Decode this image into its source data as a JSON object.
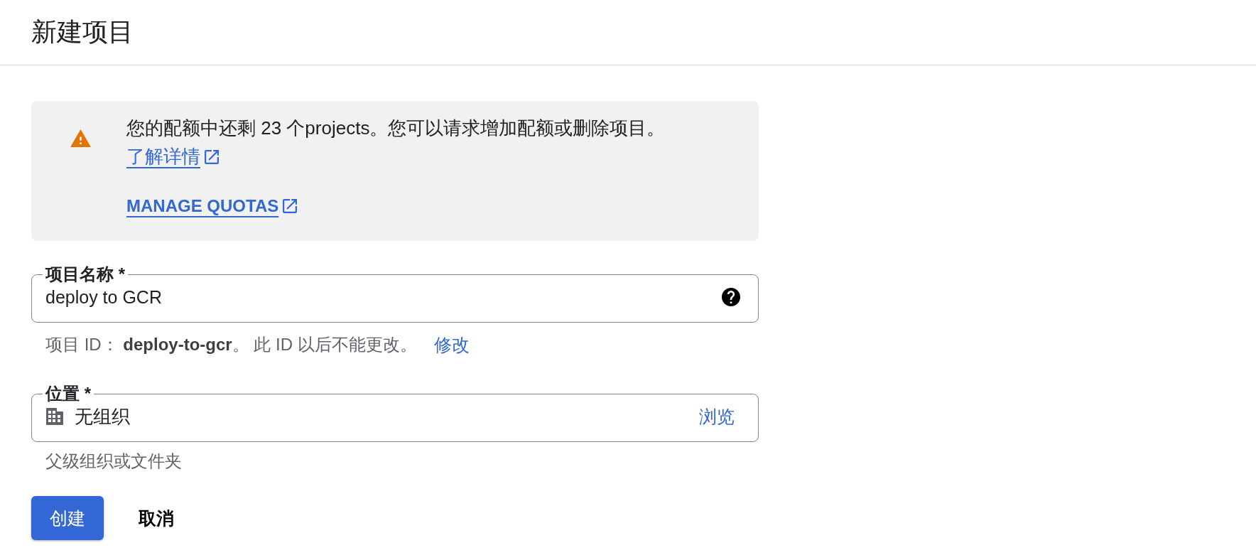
{
  "page": {
    "title": "新建项目"
  },
  "notice": {
    "kind": "warning",
    "message": "您的配额中还剩 23 个projects。您可以请求增加配额或删除项目。",
    "learn_more_link": "了解详情",
    "manage_link": "MANAGE QUOTAS"
  },
  "fields": [
    {
      "kind": "text",
      "label": "项目名称 *",
      "value": "deploy to GCR",
      "hint": "项目 ID： **deploy-to-gcr**。 此 ID 以后不能更改。",
      "hint_link": "修改"
    },
    {
      "kind": "picker",
      "label": "位置 *",
      "value": "无组织",
      "action": "浏览",
      "hint": "父级组织或文件夹"
    }
  ],
  "buttons": [
    {
      "kind": "primary",
      "label": "创建"
    },
    {
      "kind": "text",
      "label": "取消"
    }
  ]
}
